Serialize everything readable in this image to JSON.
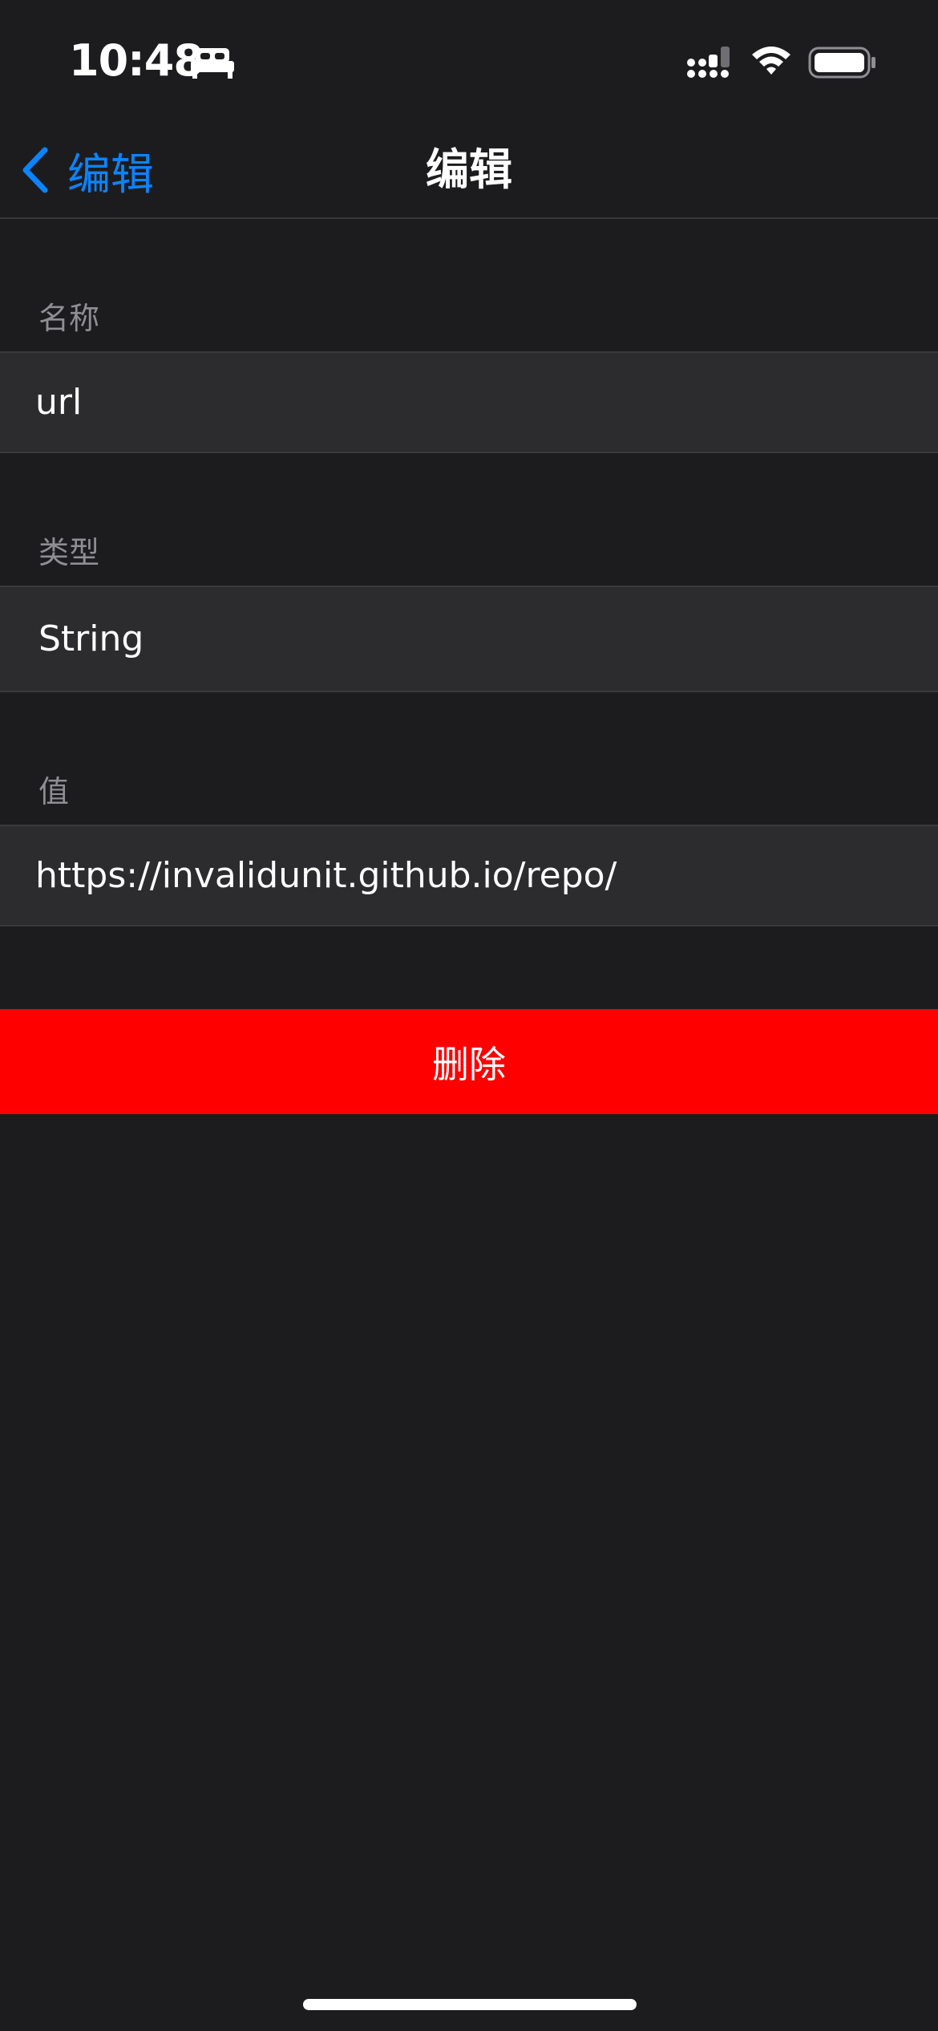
{
  "status_bar": {
    "time": "10:48",
    "focus_icon": "bed-icon",
    "signal_icon": "cellular-signal-icon",
    "wifi_icon": "wifi-icon",
    "battery_icon": "battery-icon"
  },
  "nav": {
    "back_label": "编辑",
    "title": "编辑",
    "accent_color": "#0a84ff"
  },
  "form": {
    "name_header": "名称",
    "name_value": "url",
    "type_header": "类型",
    "type_value": "String",
    "value_header": "值",
    "value_value": "https://invalidunit.github.io/repo/"
  },
  "actions": {
    "delete_label": "删除",
    "delete_color": "#ff0000"
  }
}
